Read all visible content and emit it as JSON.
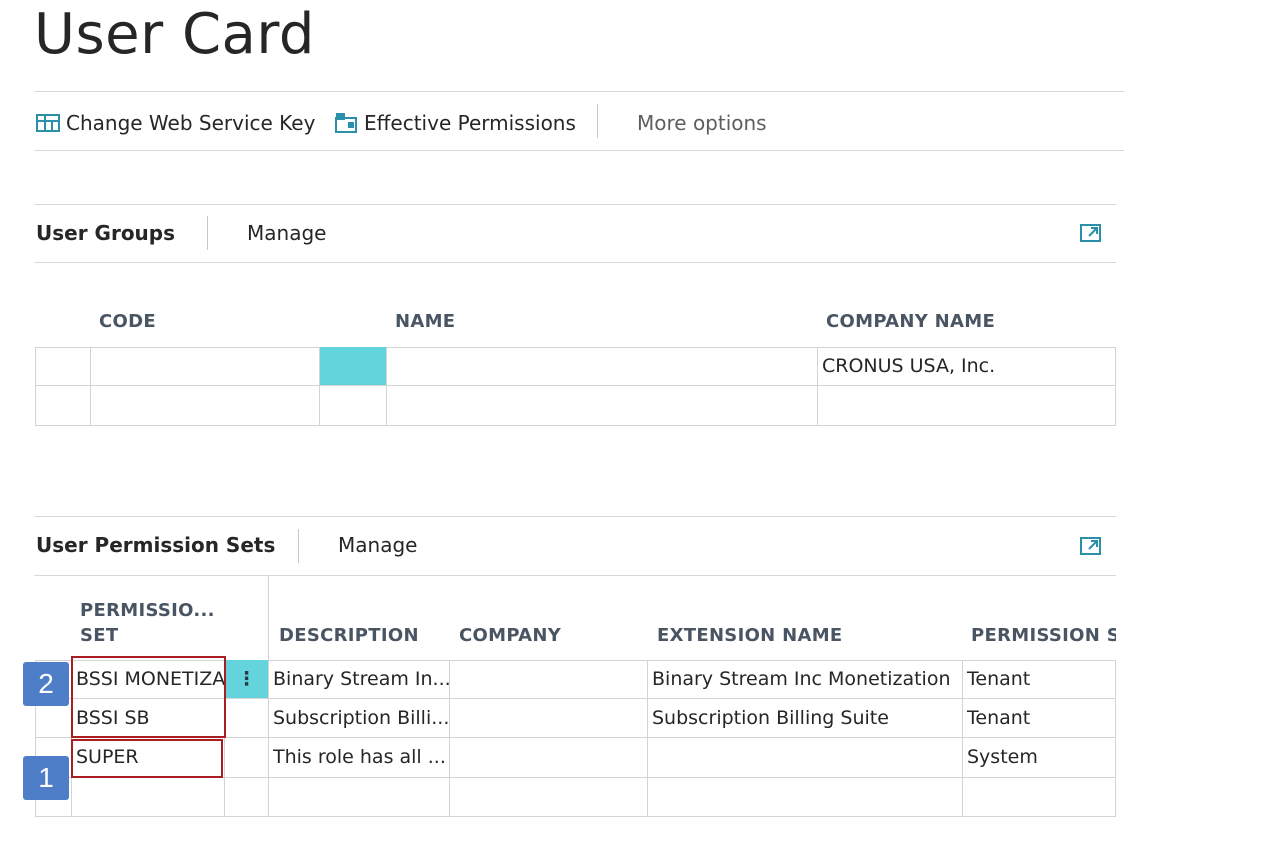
{
  "page": {
    "title": "User Card"
  },
  "actions": {
    "change_key": "Change Web Service Key",
    "effective_permissions": "Effective Permissions",
    "more_options": "More options"
  },
  "user_groups": {
    "title": "User Groups",
    "manage": "Manage",
    "columns": [
      "CODE",
      "NAME",
      "COMPANY NAME"
    ],
    "rows": [
      {
        "code": "",
        "name": "",
        "company": "CRONUS USA, Inc."
      },
      {
        "code": "",
        "name": "",
        "company": ""
      }
    ]
  },
  "permission_sets": {
    "title": "User Permission Sets",
    "manage": "Manage",
    "columns": {
      "perm_line1": "PERMISSIO...",
      "perm_line2": "SET",
      "description": "DESCRIPTION",
      "company": "COMPANY",
      "extension": "EXTENSION NAME",
      "scope": "PERMISSION SC"
    },
    "rows": [
      {
        "set": "BSSI MONETIZA",
        "description": "Binary Stream In...",
        "company": "",
        "extension": "Binary Stream Inc Monetization",
        "scope": "Tenant"
      },
      {
        "set": "BSSI SB",
        "description": "Subscription Billi...",
        "company": "",
        "extension": "Subscription Billing Suite",
        "scope": "Tenant"
      },
      {
        "set": "SUPER",
        "description": "This role has all ...",
        "company": "",
        "extension": "",
        "scope": "System"
      },
      {
        "set": "",
        "description": "",
        "company": "",
        "extension": "",
        "scope": ""
      }
    ],
    "row_menu": "⋮"
  },
  "callouts": {
    "badge_1": "1",
    "badge_2": "2"
  },
  "colors": {
    "accent": "#63d3dc",
    "callout_blue": "#4f7ec8",
    "highlight_red": "#a91e22",
    "icon_teal": "#2a8fa8"
  }
}
